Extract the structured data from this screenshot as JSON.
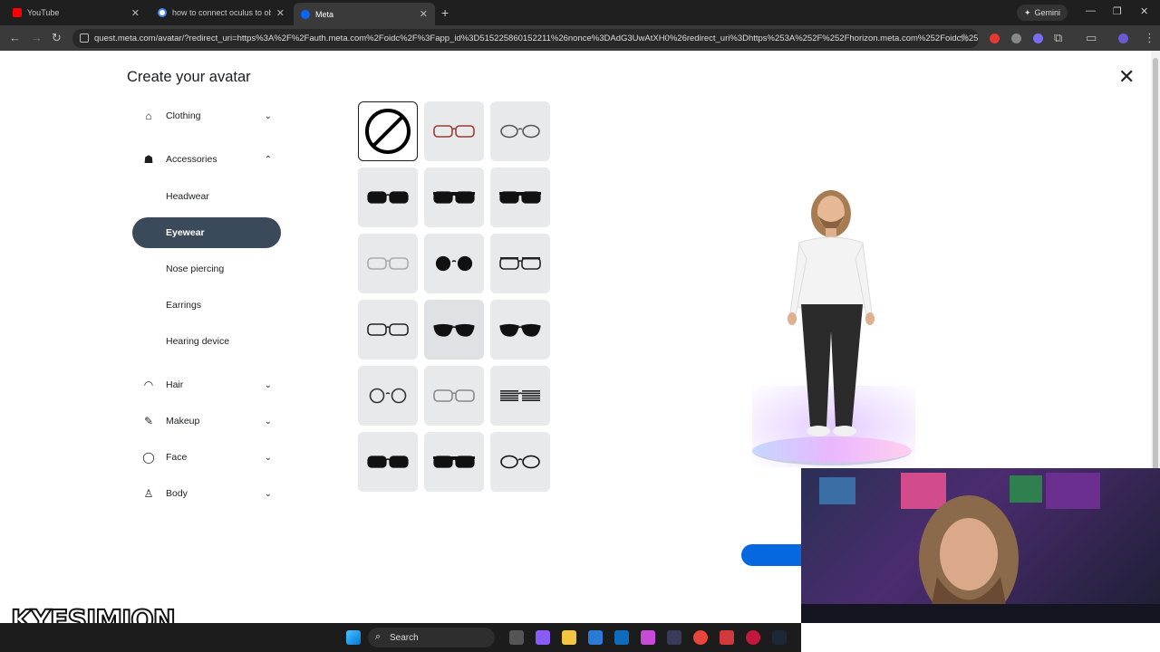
{
  "browser": {
    "tabs": [
      {
        "label": "YouTube",
        "color": "#ff0000"
      },
      {
        "label": "how to connect oculus to obs s",
        "color": "#5f6368"
      },
      {
        "label": "Meta",
        "color": "#0866ff"
      }
    ],
    "new_tab": "+",
    "gemini_label": "Gemini",
    "url": "quest.meta.com/avatar/?redirect_uri=https%3A%2F%2Fauth.meta.com%2Foidc%2F%3Fapp_id%3D515225860152211%26nonce%3DAdG3UwAtXH0%26redirect_uri%3Dhttps%253A%252F%252Fhorizon.meta.com%252Foidc%25..."
  },
  "editor": {
    "title": "Create your avatar",
    "close_glyph": "✕",
    "categories": [
      {
        "label": "Clothing",
        "icon": "hanger-icon",
        "glyph": "⌂",
        "chevron": "⌄"
      },
      {
        "label": "Accessories",
        "icon": "accessories-icon",
        "glyph": "☗",
        "chevron": "⌃"
      },
      {
        "label": "Hair",
        "icon": "hair-icon",
        "glyph": "◠",
        "chevron": "⌄"
      },
      {
        "label": "Makeup",
        "icon": "brush-icon",
        "glyph": "✎",
        "chevron": "⌄"
      },
      {
        "label": "Face",
        "icon": "face-icon",
        "glyph": "◯",
        "chevron": "⌄"
      },
      {
        "label": "Body",
        "icon": "person-icon",
        "glyph": "♙",
        "chevron": "⌄"
      }
    ],
    "accessories_sub": [
      "Headwear",
      "Eyewear",
      "Nose piercing",
      "Earrings",
      "Hearing device"
    ],
    "active_sub": "Eyewear",
    "eyewear_options": [
      {
        "style": "none",
        "lens": "#000",
        "frame": "#000",
        "selected": true
      },
      {
        "style": "rect",
        "lens": "none",
        "frame": "#9b3c32"
      },
      {
        "style": "oval",
        "lens": "none",
        "frame": "#555"
      },
      {
        "style": "wayfarer",
        "lens": "#111",
        "frame": "#111"
      },
      {
        "style": "wide",
        "lens": "#111",
        "frame": "#111"
      },
      {
        "style": "shield",
        "lens": "#111",
        "frame": "#111"
      },
      {
        "style": "thin",
        "lens": "none",
        "frame": "#aaa"
      },
      {
        "style": "round",
        "lens": "#111",
        "frame": "#111"
      },
      {
        "style": "browline",
        "lens": "none",
        "frame": "#222"
      },
      {
        "style": "rect",
        "lens": "none",
        "frame": "#222"
      },
      {
        "style": "aviator",
        "lens": "#111",
        "frame": "#111",
        "hover": true
      },
      {
        "style": "cat",
        "lens": "#111",
        "frame": "#111"
      },
      {
        "style": "round",
        "lens": "none",
        "frame": "#333"
      },
      {
        "style": "thin",
        "lens": "none",
        "frame": "#888"
      },
      {
        "style": "shutter",
        "lens": "#222",
        "frame": "#222"
      },
      {
        "style": "wayfarer",
        "lens": "#111",
        "frame": "#111"
      },
      {
        "style": "wide",
        "lens": "#111",
        "frame": "#111"
      },
      {
        "style": "oval",
        "lens": "none",
        "frame": "#111"
      }
    ]
  },
  "taskbar": {
    "search_label": "Search"
  },
  "overlay": {
    "watermark": "KYESIMJON"
  }
}
